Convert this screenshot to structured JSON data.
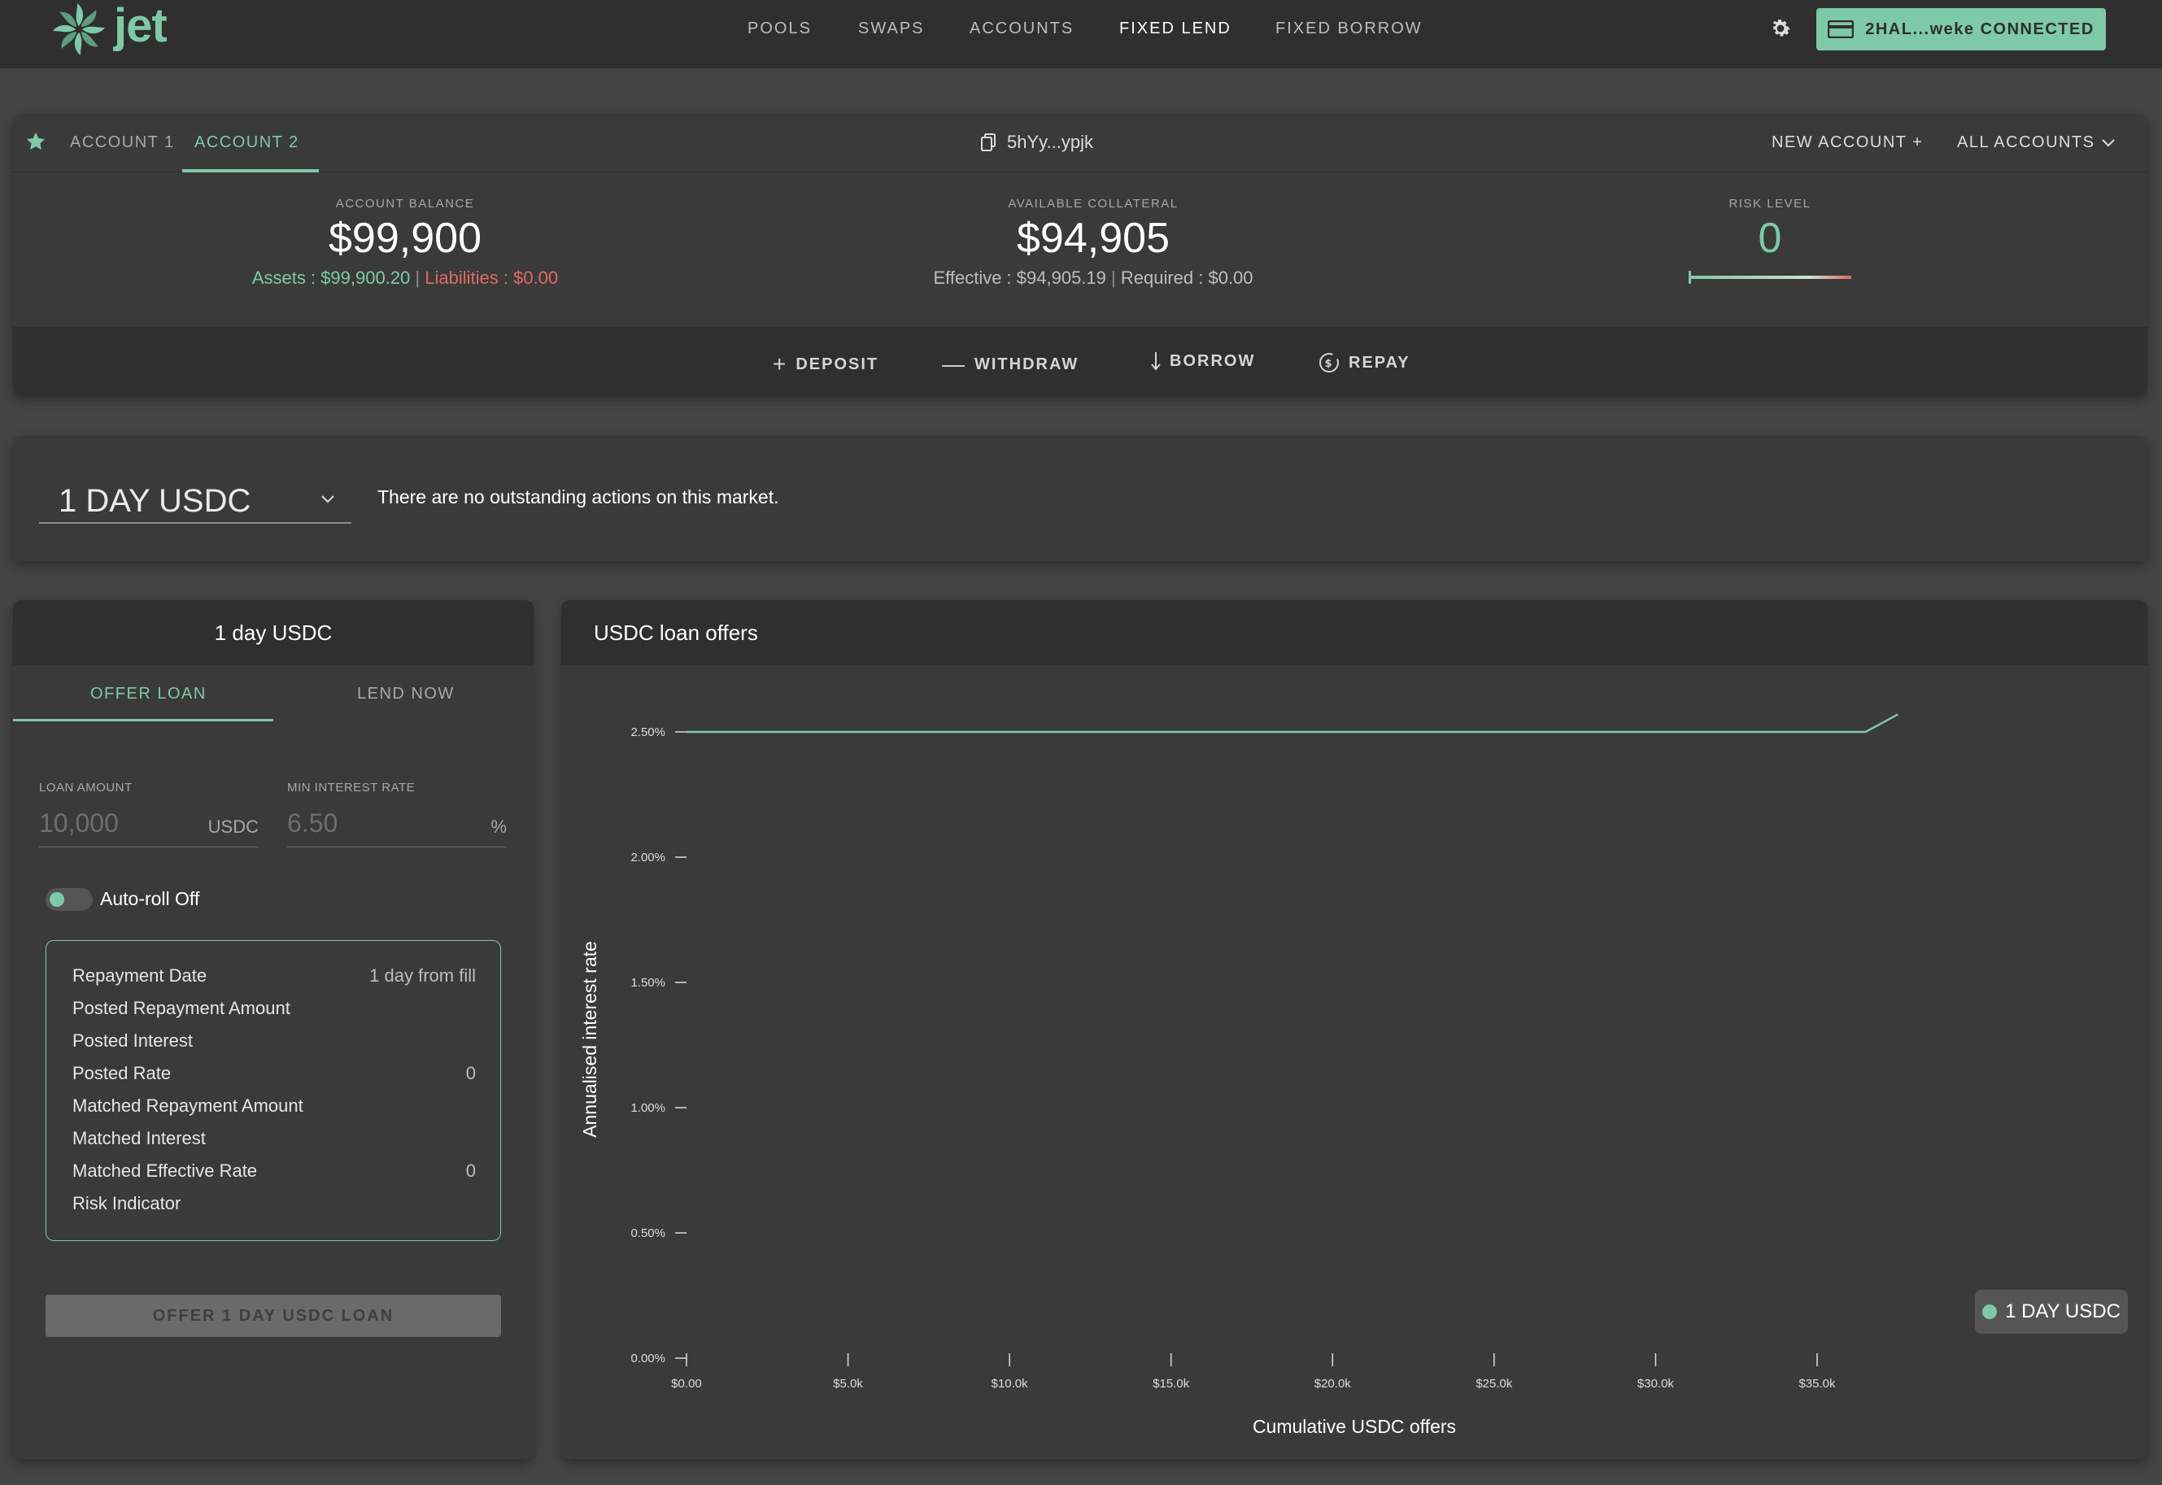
{
  "brand": {
    "name": "jet"
  },
  "nav": {
    "links": [
      "POOLS",
      "SWAPS",
      "ACCOUNTS",
      "FIXED LEND",
      "FIXED BORROW"
    ],
    "active": "FIXED LEND",
    "wallet_label": "2HAL...weke CONNECTED"
  },
  "account": {
    "tabs": [
      "ACCOUNT 1",
      "ACCOUNT 2"
    ],
    "active_tab": "ACCOUNT 2",
    "address": "5hYy...ypjk",
    "new_account": "NEW ACCOUNT +",
    "all_accounts": "ALL ACCOUNTS",
    "balance": {
      "label": "ACCOUNT BALANCE",
      "value": "$99,900",
      "assets": "Assets : $99,900.20",
      "liabilities": "Liabilities : $0.00"
    },
    "collateral": {
      "label": "AVAILABLE COLLATERAL",
      "value": "$94,905",
      "effective": "Effective : $94,905.19",
      "required": "Required : $0.00"
    },
    "risk": {
      "label": "RISK LEVEL",
      "value": "0",
      "level": 0
    },
    "actions": [
      "DEPOSIT",
      "WITHDRAW",
      "BORROW",
      "REPAY"
    ]
  },
  "market": {
    "selected": "1 DAY USDC",
    "message": "There are no outstanding actions on this market."
  },
  "offer_panel": {
    "title": "1 day USDC",
    "tabs": [
      "OFFER LOAN",
      "LEND NOW"
    ],
    "active_tab": "OFFER LOAN",
    "loan_amount": {
      "label": "LOAN AMOUNT",
      "placeholder": "10,000",
      "unit": "USDC"
    },
    "min_rate": {
      "label": "MIN INTEREST RATE",
      "placeholder": "6.50",
      "unit": "%"
    },
    "auto_roll": "Auto-roll Off",
    "summary": [
      {
        "label": "Repayment Date",
        "value": "1 day from fill"
      },
      {
        "label": "Posted Repayment Amount",
        "value": ""
      },
      {
        "label": "Posted Interest",
        "value": ""
      },
      {
        "label": "Posted Rate",
        "value": "0"
      },
      {
        "label": "Matched Repayment Amount",
        "value": ""
      },
      {
        "label": "Matched Interest",
        "value": ""
      },
      {
        "label": "Matched Effective Rate",
        "value": "0"
      },
      {
        "label": "Risk Indicator",
        "value": ""
      }
    ],
    "submit": "OFFER 1 DAY USDC LOAN"
  },
  "chart_panel": {
    "title": "USDC loan offers"
  },
  "colors": {
    "accent": "#7ec9a8",
    "danger": "#e06a64",
    "bg": "#444444",
    "panel": "#3a3a3a",
    "header": "#2f2f2f"
  },
  "chart_data": {
    "type": "line",
    "title": "USDC loan offers",
    "xlabel": "Cumulative USDC offers",
    "ylabel": "Annualised interest rate",
    "x_ticks": [
      "$0.00",
      "$5.0k",
      "$10.0k",
      "$15.0k",
      "$20.0k",
      "$25.0k",
      "$30.0k",
      "$35.0k"
    ],
    "y_ticks": [
      "0.00%",
      "0.50%",
      "1.00%",
      "1.50%",
      "2.00%",
      "2.50%"
    ],
    "xlim": [
      0,
      37500
    ],
    "ylim": [
      0,
      2.5
    ],
    "series": [
      {
        "name": "1 DAY USDC",
        "x": [
          0,
          36500,
          37500
        ],
        "y": [
          2.5,
          2.5,
          2.57
        ]
      }
    ],
    "legend": "bottom-right",
    "grid": false
  }
}
